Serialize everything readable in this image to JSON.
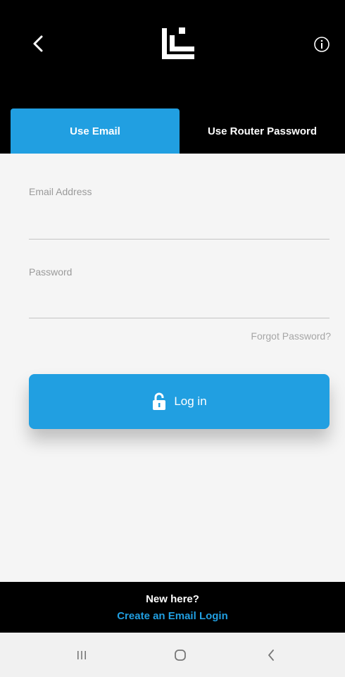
{
  "tabs": {
    "email_label": "Use Email",
    "router_label": "Use Router Password"
  },
  "form": {
    "email_label": "Email Address",
    "email_value": "",
    "password_label": "Password",
    "password_value": "",
    "forgot_label": "Forgot Password?",
    "login_label": "Log in"
  },
  "footer": {
    "question": "New here?",
    "link": "Create an Email Login"
  },
  "colors": {
    "accent": "#219fe1",
    "header_bg": "#000000",
    "content_bg": "#f5f5f5"
  },
  "icons": {
    "back": "chevron-left-icon",
    "logo": "linksys-logo",
    "info": "info-icon",
    "lock": "lock-open-icon",
    "nav_recents": "recents-icon",
    "nav_home": "home-icon",
    "nav_back": "nav-back-icon"
  }
}
